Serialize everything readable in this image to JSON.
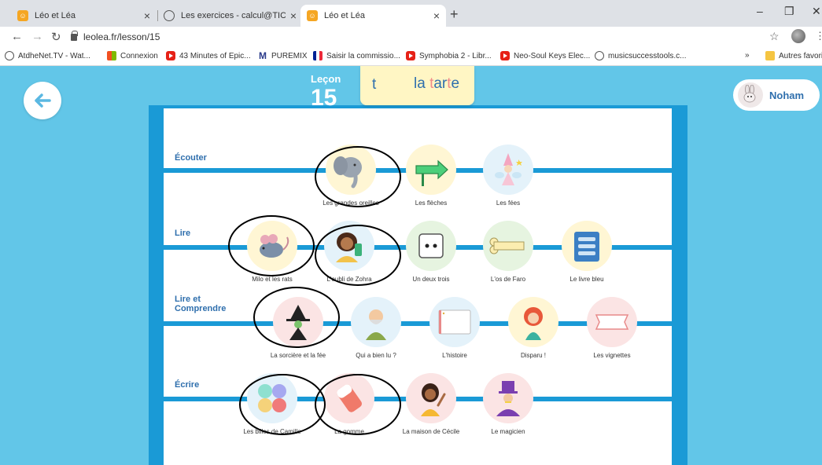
{
  "browser": {
    "tabs": [
      {
        "title": "Léo et Léa",
        "color": "#f5a623"
      },
      {
        "title": "Les exercices - calcul@TICE",
        "color": "#888888"
      },
      {
        "title": "Léo et Léa",
        "color": "#f5a623"
      }
    ],
    "new_tab": "+",
    "url": "leolea.fr/lesson/15",
    "bookmarks": [
      {
        "label": "AtdheNet.TV - Wat...",
        "icon": "globe-icon"
      },
      {
        "label": "Connexion",
        "icon": "microsoft-icon"
      },
      {
        "label": "43 Minutes of Epic...",
        "icon": "youtube-icon"
      },
      {
        "label": "PUREMIX",
        "icon": "puremix-icon"
      },
      {
        "label": "Saisir la commissio...",
        "icon": "flag-icon"
      },
      {
        "label": "Symphobia 2 - Libr...",
        "icon": "youtube-icon"
      },
      {
        "label": "Neo-Soul Keys Elec...",
        "icon": "youtube-icon"
      },
      {
        "label": "musicsuccesstools.c...",
        "icon": "globe-icon"
      }
    ],
    "more_bookmarks": "»",
    "other_favorites": "Autres favoris"
  },
  "lesson": {
    "label": "Leçon",
    "number": "15",
    "letter": "t",
    "word_prefix": "la ",
    "word_t1": "t",
    "word_ar": "ar",
    "word_t2": "t",
    "word_end": "e",
    "user": "Noham"
  },
  "rows": [
    {
      "label": "Écouter",
      "exercises": [
        "Les grandes oreilles",
        "Les flèches",
        "Les fées"
      ]
    },
    {
      "label": "Lire",
      "exercises": [
        "Milo et les rats",
        "L'oubli de Zohra",
        "Un deux trois",
        "L'os de Faro",
        "Le livre bleu"
      ]
    },
    {
      "label": "Lire et Comprendre",
      "exercises": [
        "La sorcière et la fée",
        "Qui a bien lu ?",
        "L'histoire",
        "Disparu !",
        "Les vignettes"
      ]
    },
    {
      "label": "Écrire",
      "exercises": [
        "Les billes de Camille",
        "La gomme",
        "La maison de Cécile",
        "Le magicien"
      ]
    }
  ],
  "colors": {
    "background": "#62c6e8",
    "board": "#1a9ad6",
    "label_blue": "#2f6fad",
    "highlight_pink": "#f08a8a"
  }
}
